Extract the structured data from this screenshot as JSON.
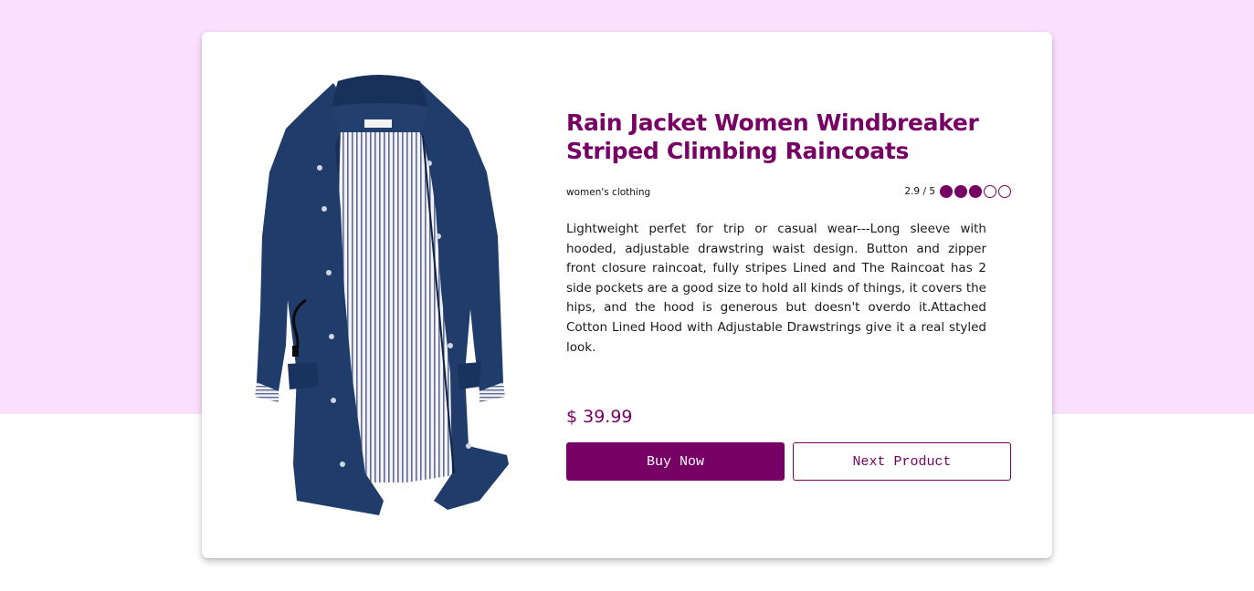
{
  "product": {
    "title": "Rain Jacket Women Windbreaker Striped Climbing Raincoats",
    "category": "women's clothing",
    "rating_text": "2.9 / 5",
    "rating_value": 2.9,
    "rating_max": 5,
    "description": "Lightweight perfet for trip or casual wear---Long sleeve with hooded, adjustable drawstring waist design. Button and zipper front closure raincoat, fully stripes Lined and The Raincoat has 2 side pockets are a good size to hold all kinds of things, it covers the hips, and the hood is generous but doesn't overdo it.Attached Cotton Lined Hood with Adjustable Drawstrings give it a real styled look.",
    "price": "$ 39.99",
    "image": "navy-rain-jacket-photo"
  },
  "actions": {
    "buy_label": "Buy Now",
    "next_label": "Next Product"
  },
  "colors": {
    "accent": "#760064",
    "background_top": "#fbe0fe",
    "jacket": "#1d3a66"
  }
}
